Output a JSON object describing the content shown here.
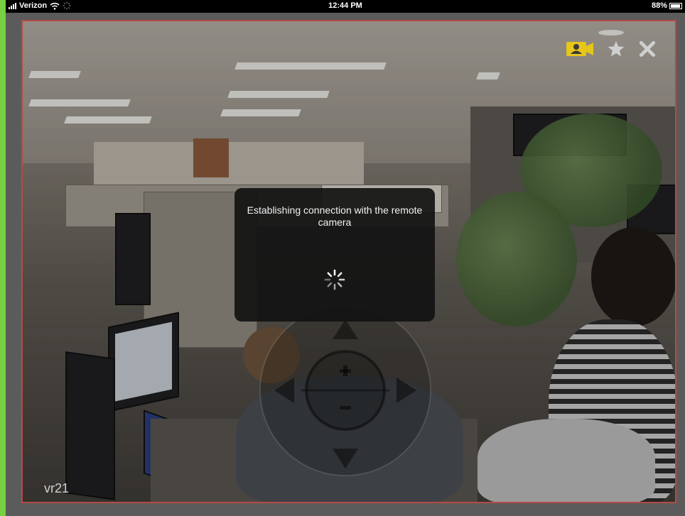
{
  "status_bar": {
    "carrier": "Verizon",
    "time": "12:44 PM",
    "battery": "88%"
  },
  "camera": {
    "id_label": "vr21"
  },
  "toolbar": {
    "camera_icon": "video-camera-person-icon",
    "favorite_icon": "star-icon",
    "close_icon": "close-icon",
    "accent_color": "#e6c619"
  },
  "dialog": {
    "message": "Establishing connection with the remote camera",
    "spinner_icon": "spinner-icon"
  },
  "ptz": {
    "up_icon": "arrow-up-icon",
    "down_icon": "arrow-down-icon",
    "left_icon": "arrow-left-icon",
    "right_icon": "arrow-right-icon",
    "zoom_in_icon": "plus-icon",
    "zoom_out_icon": "minus-icon"
  }
}
